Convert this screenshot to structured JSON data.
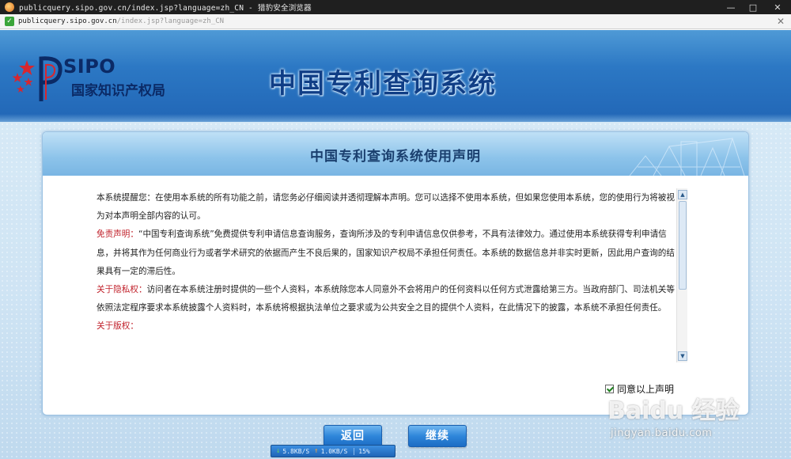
{
  "window": {
    "title": "publicquery.sipo.gov.cn/index.jsp?language=zh_CN - 猎豹安全浏览器",
    "min_glyph": "—",
    "max_glyph": "□",
    "close_glyph": "✕"
  },
  "address_bar": {
    "host": "publicquery.sipo.gov.cn",
    "path": "/index.jsp?language=zh_CN",
    "secure_glyph": "✓",
    "close_glyph": "✕"
  },
  "header": {
    "logo_text": "SIPO",
    "logo_subtitle": "国家知识产权局",
    "system_title": "中国专利查询系统",
    "colors": {
      "banner": "#2c78c4",
      "title": "#103e86"
    }
  },
  "panel": {
    "title": "中国专利查询系统使用声明",
    "paragraphs": [
      {
        "label": "",
        "text": "本系统提醒您：在使用本系统的所有功能之前，请您务必仔细阅读并透彻理解本声明。您可以选择不使用本系统，但如果您使用本系统，您的使用行为将被视为对本声明全部内容的认可。"
      },
      {
        "label": "免责声明：",
        "text": "“中国专利查询系统”免费提供专利申请信息查询服务，查询所涉及的专利申请信息仅供参考，不具有法律效力。通过使用本系统获得专利申请信息，并将其作为任何商业行为或者学术研究的依据而产生不良后果的，国家知识产权局不承担任何责任。本系统的数据信息并非实时更新，因此用户查询的结果具有一定的滞后性。"
      },
      {
        "label": "关于隐私权：",
        "text": "访问者在本系统注册时提供的一些个人资料，本系统除您本人同意外不会将用户的任何资料以任何方式泄露给第三方。当政府部门、司法机关等依照法定程序要求本系统披露个人资料时，本系统将根据执法单位之要求或为公共安全之目的提供个人资料，在此情况下的披露，本系统不承担任何责任。"
      },
      {
        "label": "关于版权：",
        "text": ""
      }
    ],
    "agree_label": "同意以上声明",
    "agree_checked": true
  },
  "actions": {
    "back_label": "返回",
    "next_label": "继续"
  },
  "status": {
    "download_speed": "5.8KB/S",
    "upload_speed": "1.0KB/S",
    "percent": "15%"
  },
  "watermark": {
    "brand": "Baidu 经验",
    "url": "jingyan.baidu.com"
  }
}
